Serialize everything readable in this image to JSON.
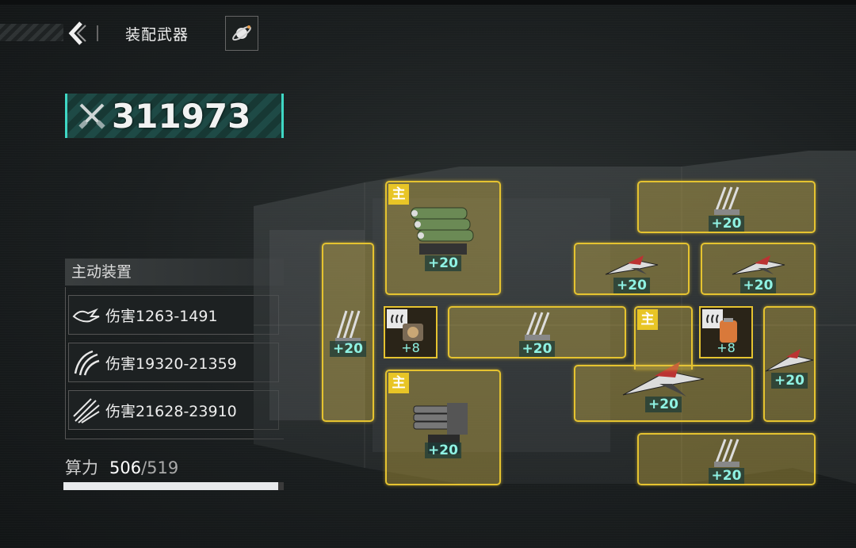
{
  "header": {
    "title": "装配武器",
    "back_icon": "chevron-left-icon",
    "planet_icon": "planet-icon"
  },
  "power": {
    "icon": "crossed-swords-icon",
    "value": "311973"
  },
  "active_devices": {
    "heading": "主动装置",
    "items": [
      {
        "icon": "claw-strike-icon",
        "label": "伤害1263-1491"
      },
      {
        "icon": "triple-claw-icon",
        "label": "伤害19320-21359"
      },
      {
        "icon": "missile-burst-icon",
        "label": "伤害21628-23910"
      }
    ]
  },
  "compute": {
    "label": "算力",
    "current": "506",
    "separator": "/",
    "max": "519",
    "fill_fraction": 0.975
  },
  "slots": {
    "main_tag": "主",
    "items": [
      {
        "id": "s1",
        "bonus": "+20",
        "weapon": "missile-pod"
      },
      {
        "id": "s2",
        "bonus": "+20",
        "weapon": "missile-rack"
      },
      {
        "id": "s3",
        "bonus": "+20",
        "weapon": "missile-rack"
      },
      {
        "id": "s4",
        "bonus": "+20",
        "weapon": "fighter"
      },
      {
        "id": "s5",
        "bonus": "+20",
        "weapon": "fighter"
      },
      {
        "id": "s6",
        "bonus": "+8",
        "weapon": "engine-module"
      },
      {
        "id": "s7",
        "bonus": "+20",
        "weapon": "missile-rack"
      },
      {
        "id": "s8",
        "bonus": "+8",
        "weapon": "fuel-module"
      },
      {
        "id": "s9",
        "bonus": "+20",
        "weapon": "fighter"
      },
      {
        "id": "s10",
        "bonus": "+20",
        "weapon": "fighter"
      },
      {
        "id": "s11",
        "bonus": "+20",
        "weapon": "heavy-cannon"
      },
      {
        "id": "s12",
        "bonus": "+20",
        "weapon": "missile-rack"
      }
    ]
  },
  "colors": {
    "slot_border": "#e5c330",
    "bonus_text": "#8ff2e3",
    "accent_teal": "#3fd7c4"
  }
}
